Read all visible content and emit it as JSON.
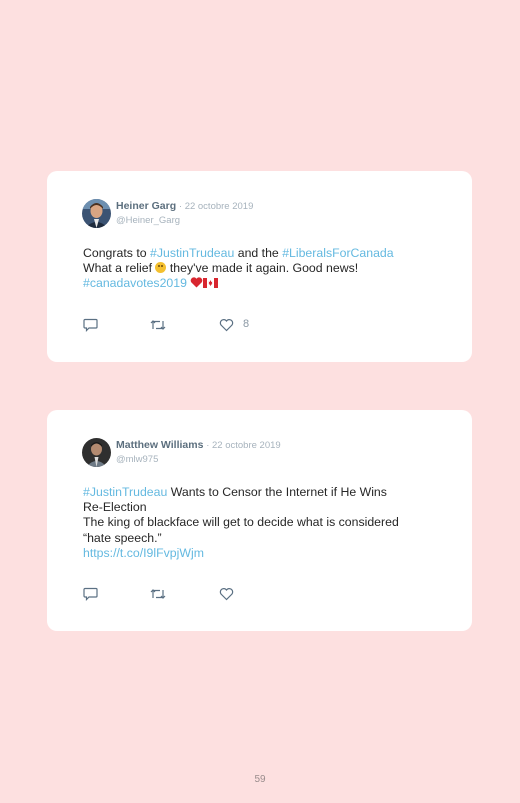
{
  "tweets": [
    {
      "name": "Heiner Garg",
      "date": "· 22 octobre 2019",
      "handle": "@Heiner_Garg",
      "line1": [
        "Congrats to ",
        "#JustinTrudeau",
        " and the ",
        "#LiberalsForCanada"
      ],
      "line2": [
        "What a relief ",
        " they've made it again. Good news!"
      ],
      "line3": [
        "#canadavotes2019"
      ],
      "likes": "8"
    },
    {
      "name": "Matthew Williams",
      "date": "· 22 octobre 2019",
      "handle": "@mlw975",
      "line1": [
        "#JustinTrudeau",
        " Wants to Censor the Internet if He Wins"
      ],
      "line2": "Re-Election",
      "line3": "The king of blackface will get to decide what is considered",
      "line4": "“hate speech.”",
      "line5": "https://t.co/I9lFvpjWjm"
    }
  ],
  "icons": [
    "reply-icon",
    "retweet-icon",
    "like-icon",
    "heart-emoji",
    "canada-flag-emoji",
    "grinning-face-emoji"
  ],
  "colors": {
    "background": "#fde0e0",
    "card": "#ffffff",
    "link": "#64b9e0",
    "name": "#5c6f7e",
    "meta": "#a7b3bd"
  },
  "page": {
    "number": "59"
  }
}
